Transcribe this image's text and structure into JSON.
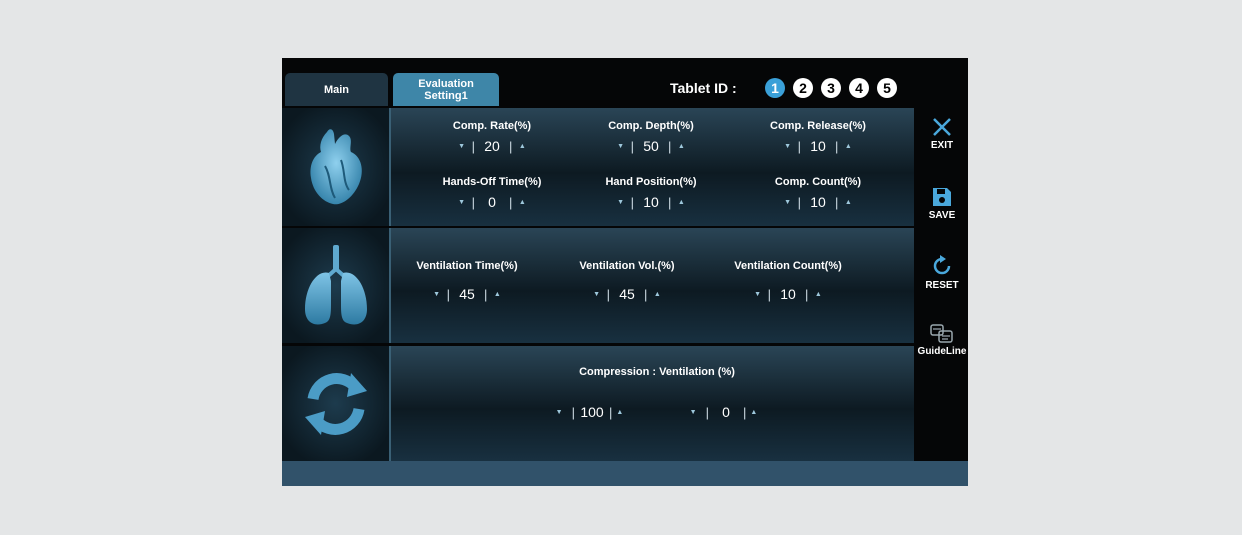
{
  "tabs": [
    {
      "label": "Main"
    },
    {
      "label_line1": "Evaluation",
      "label_line2": "Setting1"
    }
  ],
  "tablet": {
    "label": "Tablet ID :",
    "ids": [
      "1",
      "2",
      "3",
      "4",
      "5"
    ],
    "active": "1"
  },
  "compression": {
    "rate": {
      "label": "Comp. Rate(%)",
      "value": "20"
    },
    "depth": {
      "label": "Comp. Depth(%)",
      "value": "50"
    },
    "release": {
      "label": "Comp. Release(%)",
      "value": "10"
    },
    "hands_off": {
      "label": "Hands-Off Time(%)",
      "value": "0"
    },
    "hand_position": {
      "label": "Hand Position(%)",
      "value": "10"
    },
    "count": {
      "label": "Comp. Count(%)",
      "value": "10"
    }
  },
  "ventilation": {
    "time": {
      "label": "Ventilation Time(%)",
      "value": "45"
    },
    "volume": {
      "label": "Ventilation Vol.(%)",
      "value": "45"
    },
    "count": {
      "label": "Ventilation Count(%)",
      "value": "10"
    }
  },
  "ratio": {
    "label": "Compression : Ventilation (%)",
    "compression_value": "100",
    "ventilation_value": "0"
  },
  "toolbar": {
    "exit": "EXIT",
    "save": "SAVE",
    "reset": "RESET",
    "guideline": "GuideLine"
  },
  "colors": {
    "accent": "#3e86a8",
    "active_id": "#3aa0d8",
    "background": "#050607",
    "footer": "#31526a"
  }
}
